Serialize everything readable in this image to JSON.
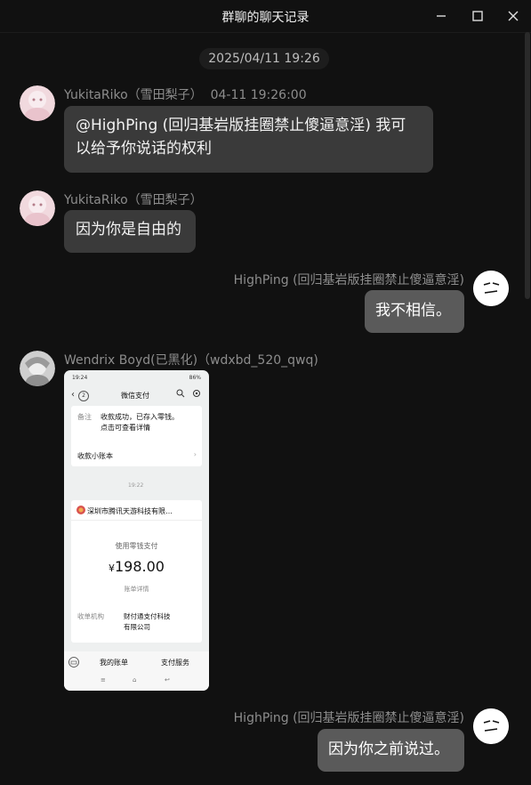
{
  "window": {
    "title": "群聊的聊天记录"
  },
  "timestamp_divider": "2025/04/11 19:26",
  "messages": [
    {
      "sender": "YukitaRiko（雪田梨子）",
      "time": "04-11 19:26:00",
      "lines": [
        "@HighPing (回归基岩版挂圈禁止傻逼意淫) 我可",
        "以给予你说话的权利"
      ]
    },
    {
      "sender": "YukitaRiko（雪田梨子）",
      "text": "因为你是自由的"
    },
    {
      "sender": "HighPing (回归基岩版挂圈禁止傻逼意淫)",
      "text": "我不相信。"
    },
    {
      "sender": "Wendrix Boyd(已黑化)（wdxbd_520_qwq)"
    },
    {
      "sender": "HighPing (回归基岩版挂圈禁止傻逼意淫)",
      "text": "因为你之前说过。"
    }
  ],
  "screenshot": {
    "status_time": "19:24",
    "status_battery": "86%",
    "back_badge": "2",
    "header_title": "微信支付",
    "note_label": "备注",
    "note_text_1": "收款成功，已存入零钱。",
    "note_text_2": "点击可查看详情",
    "ledger_link": "收款小账本",
    "time_divider": "19:22",
    "merchant": "深圳市腾讯天游科技有限…",
    "pay_method": "使用零钱支付",
    "amount": "198.00",
    "currency": "¥",
    "detail_link": "账单详情",
    "acquirer_label": "收单机构",
    "acquirer_1": "财付通支付科技",
    "acquirer_2": "有限公司",
    "tab_1": "我的账单",
    "tab_2": "支付服务"
  }
}
